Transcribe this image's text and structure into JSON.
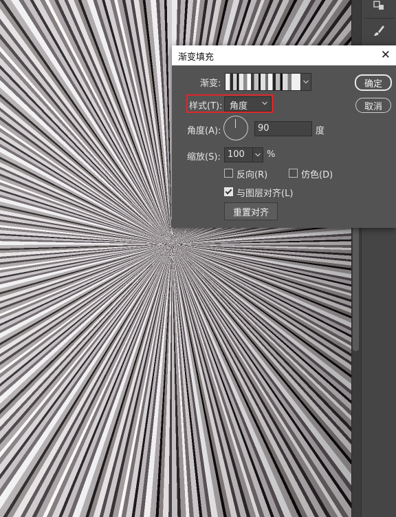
{
  "dialog": {
    "title": "渐变填充",
    "close_glyph": "✕",
    "gradient_label": "渐变:",
    "style_label": "样式(T):",
    "style_value": "角度",
    "angle_label": "角度(A):",
    "angle_value": "90",
    "angle_unit": "度",
    "scale_label": "缩放(S):",
    "scale_value": "100",
    "scale_unit": "%",
    "reverse_label": "反向(R)",
    "reverse_checked": false,
    "dither_label": "仿色(D)",
    "dither_checked": false,
    "align_label": "与图层对齐(L)",
    "align_checked": true,
    "reset_align_label": "重置对齐",
    "ok_label": "确定",
    "cancel_label": "取消"
  },
  "icons": {
    "caret": "chevron-down-icon",
    "tools": [
      "panel-icon",
      "brush-icon",
      "list-icon",
      "layers-icon"
    ]
  },
  "colors": {
    "dialog_bg": "#535353",
    "highlight": "#e0262c"
  }
}
